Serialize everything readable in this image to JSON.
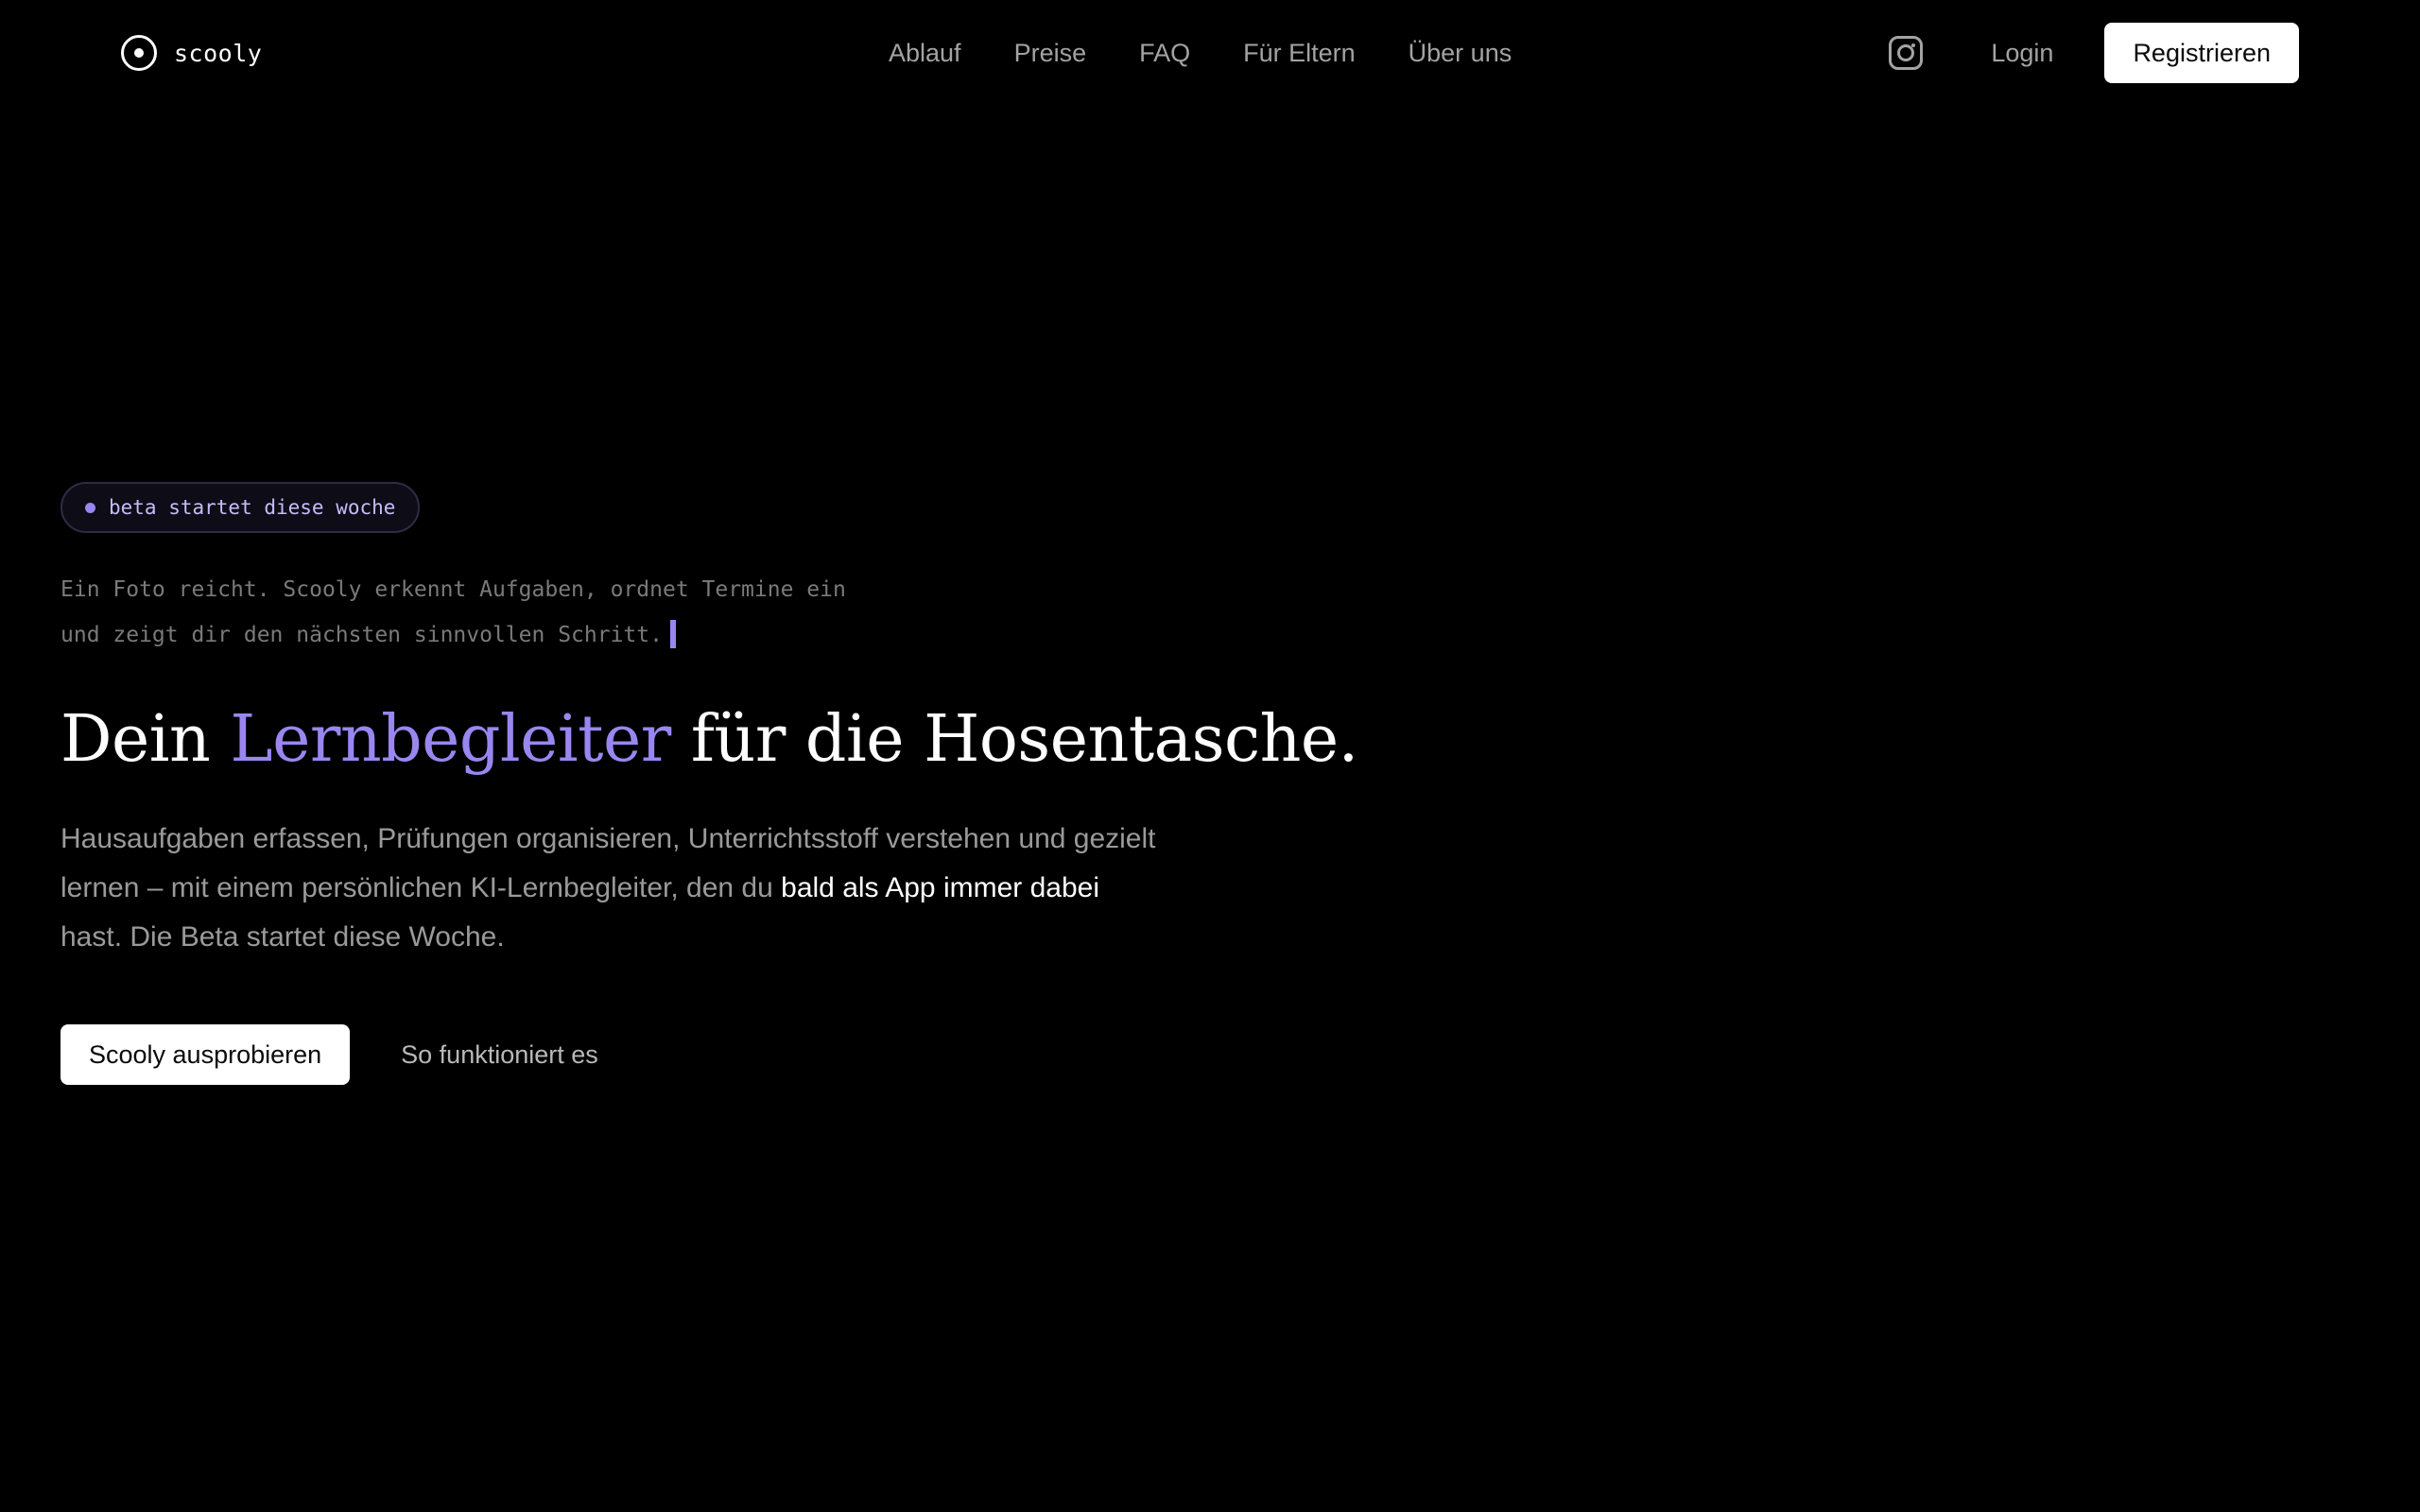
{
  "brand": {
    "name": "scooly",
    "icon": "circle-dot-icon"
  },
  "nav": {
    "links": [
      "Ablauf",
      "Preise",
      "FAQ",
      "Für Eltern",
      "Über uns"
    ],
    "instagram_icon": "instagram-icon",
    "login_label": "Login",
    "register_label": "Registrieren"
  },
  "hero": {
    "badge": "beta startet diese woche",
    "typing": {
      "line1": "Ein Foto reicht. Scooly erkennt Aufgaben, ordnet Termine ein",
      "line2": "und zeigt dir den nächsten sinnvollen Schritt."
    },
    "headline": {
      "before": "Dein ",
      "accent": "Lernbegleiter",
      "after": " für die Hosentasche."
    },
    "description": {
      "part1": "Hausaufgaben erfassen, Prüfungen organisieren, Unterrichtsstoff verstehen und gezielt lernen – mit einem persönlichen KI-Lernbegleiter, den du ",
      "highlight": "bald als App immer dabei",
      "part2": " hast. Die Beta startet diese Woche."
    },
    "primary_cta": "Scooly ausprobieren",
    "secondary_cta": "So funktioniert es"
  },
  "colors": {
    "background": "#000000",
    "accent": "#9a86f0",
    "muted_text": "#a3a3a3",
    "button_bg": "#ffffff"
  }
}
